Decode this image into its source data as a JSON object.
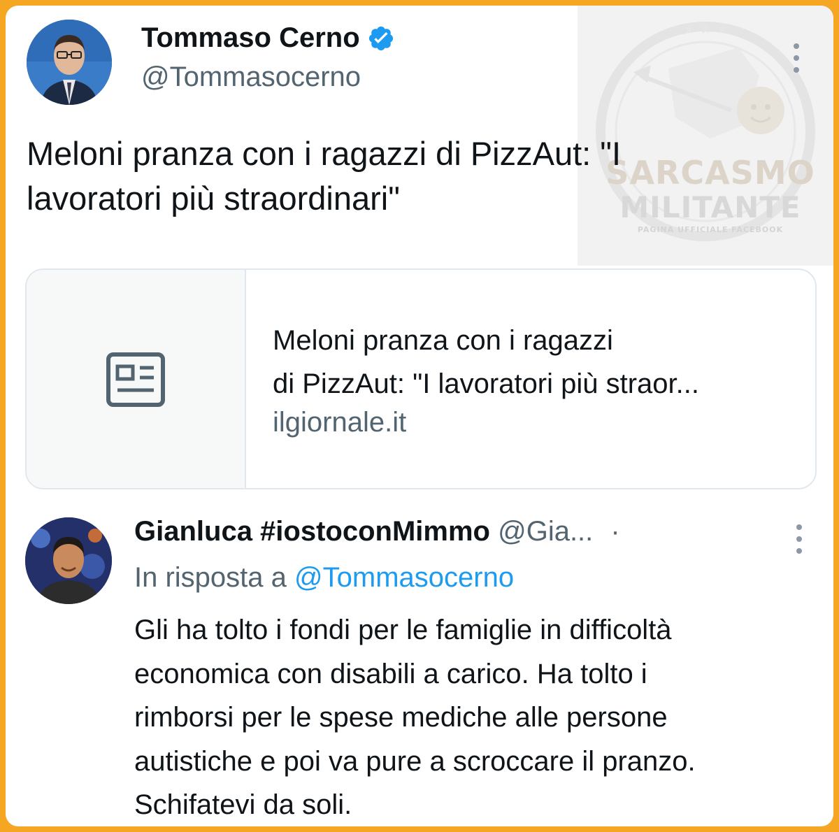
{
  "tweet": {
    "author_name": "Tommaso Cerno",
    "author_handle": "@Tommasocerno",
    "verified_icon": "verified-badge-icon",
    "text": "Meloni pranza con i ragazzi di PizzAut: \"I lavoratori più straordinari\"",
    "text_lines": [
      "Meloni pranza con i ragazzi di PizzAut: \"I",
      "lavoratori più straordinari\""
    ]
  },
  "link_card": {
    "thumbnail_icon": "article-icon",
    "title_lines": [
      "Meloni pranza con i ragazzi",
      "di PizzAut: \"I lavoratori più straor..."
    ],
    "domain": "ilgiornale.it"
  },
  "reply": {
    "author_name": "Gianluca #iostoconMimmo",
    "author_handle": "@Gia...",
    "separator": "·",
    "in_reply_prefix": "In risposta a",
    "in_reply_mention": "@Tommasocerno",
    "text_lines": [
      "Gli ha tolto i fondi per le famiglie in difficoltà",
      "economica con disabili a carico. Ha tolto i",
      "rimborsi per le spese mediche alle persone",
      "autistiche e poi va pure a scroccare il pranzo.",
      "Schifatevi da soli."
    ]
  },
  "watermark": {
    "line1": "SARCASMO",
    "line2": "MILITANTE",
    "line3": "PAGINA UFFICIALE FACEBOOK"
  },
  "colors": {
    "border": "#f5a623",
    "link_blue": "#1d9bf0",
    "secondary_text": "#536471",
    "primary_text": "#0f1419"
  }
}
